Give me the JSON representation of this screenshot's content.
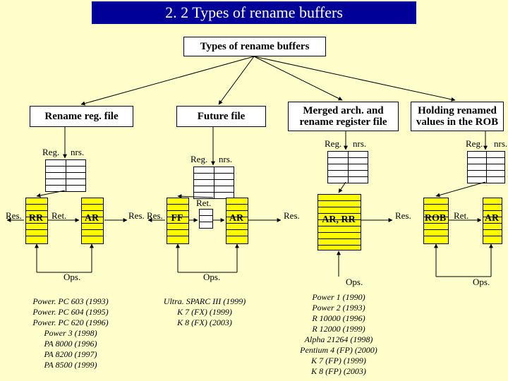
{
  "title": "2. 2 Types of rename buffers",
  "root": "Types of rename buffers",
  "branches": {
    "b1": "Rename reg. file",
    "b2": "Future file",
    "b3": "Merged arch. and rename register file",
    "b4": "Holding renamed values in the ROB"
  },
  "labels": {
    "reg": "Reg.",
    "nrs": "nrs.",
    "res": "Res.",
    "ret": "Ret.",
    "ops": "Ops."
  },
  "boxes": {
    "rr": "RR",
    "ar": "AR",
    "ff": "FF",
    "arrr": "AR, RR",
    "rob": "ROB"
  },
  "examples": {
    "col1": "Power. PC 603 (1993)\nPower. PC 604 (1995)\nPower. PC 620 (1996)\nPower 3 (1998)\nPA 8000 (1996)\nPA 8200 (1997)\nPA 8500 (1999)",
    "col2": "Ultra. SPARC III (1999)\nK 7 (FX) (1999)\nK 8 (FX) (2003)",
    "col3": "Power 1 (1990)\nPower 2 (1993)\nR 10000 (1996)\nR 12000 (1999)\nAlpha 21264 (1998)\nPentium 4 (FP) (2000)\nK 7 (FP) (1999)\nK 8 (FP) (2003)"
  }
}
